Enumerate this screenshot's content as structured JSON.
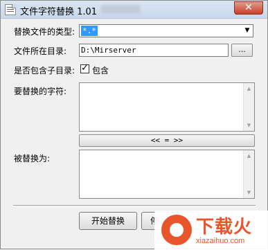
{
  "window": {
    "title": "文件字符替换 1.01",
    "close_label": "✕"
  },
  "form": {
    "type_label": "替换文件的类型:",
    "type_value": "*.*",
    "dir_label": "文件所在目录:",
    "dir_value": "D:\\Mirserver",
    "browse_label": "...",
    "subdir_label": "是否包含子目录:",
    "subdir_checked": true,
    "subdir_check_label": "包含",
    "find_label": "要替换的字符:",
    "swap_label": "<< = >>",
    "replace_label": "被替换为:"
  },
  "buttons": {
    "start": "开始替换",
    "stop_partial": "停"
  },
  "watermark": {
    "title": "下载火",
    "sub": "xiazaihuo.com"
  },
  "colors": {
    "titlebar": "#c9d8ea",
    "selection": "#3399ff",
    "close": "#c6412b",
    "watermark": "#e8542b"
  }
}
